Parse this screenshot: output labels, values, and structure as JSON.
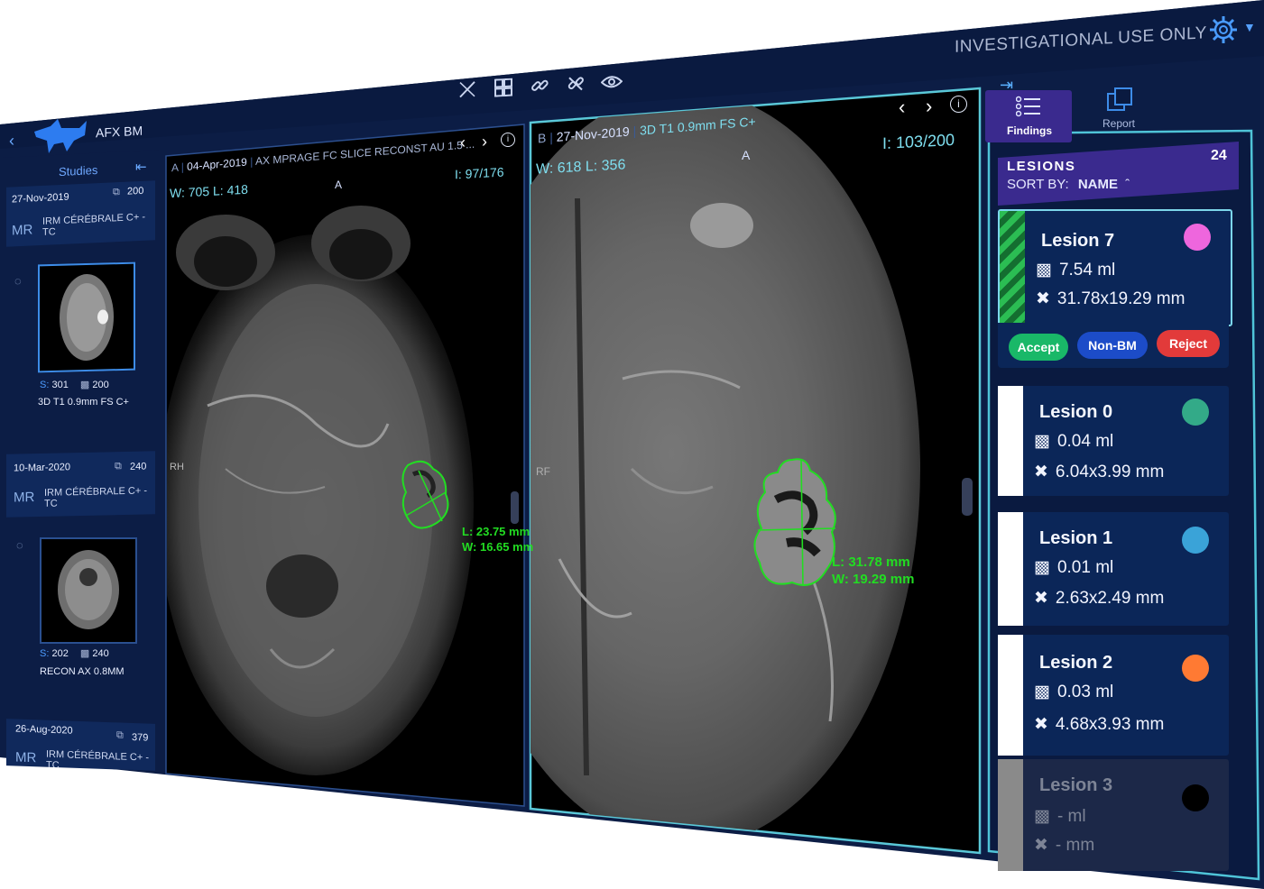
{
  "header": {
    "disclaimer": "INVESTIGATIONAL USE ONLY",
    "app_name": "AFX BM"
  },
  "toolbar": {
    "icons": [
      "measure-off-icon",
      "layout-grid-icon",
      "link-icon",
      "unlink-icon",
      "eye-icon"
    ]
  },
  "studies": {
    "title": "Studies",
    "items": [
      {
        "date": "27-Nov-2019",
        "count": "200",
        "modality": "MR",
        "description": "IRM CÉRÉBRALE C+ -TC",
        "series_s_label": "S:",
        "series_s": "301",
        "series_img": "200",
        "series_name": "3D T1 0.9mm FS C+"
      },
      {
        "date": "10-Mar-2020",
        "count": "240",
        "modality": "MR",
        "description": "IRM CÉRÉBRALE C+ -TC",
        "series_s_label": "S:",
        "series_s": "202",
        "series_img": "240",
        "series_name": "RECON AX 0.8MM"
      },
      {
        "date": "26-Aug-2020",
        "count": "379",
        "modality": "MR",
        "description": "IRM CÉRÉBRALE C+ -TC"
      }
    ]
  },
  "viewer_a": {
    "label": "A",
    "date": "04-Apr-2019",
    "series": "AX MPRAGE FC SLICE RECONST AU 1.5 ...",
    "window": "W: 705",
    "level": "L: 418",
    "image_index": "I: 97/176",
    "orient_top": "A",
    "orient_left": "RH",
    "measure_l": "L: 23.75 mm",
    "measure_w": "W: 16.65 mm"
  },
  "viewer_b": {
    "label": "B",
    "date": "27-Nov-2019",
    "series": "3D T1 0.9mm FS C+",
    "window": "W: 618",
    "level": "L: 356",
    "image_index": "I: 103/200",
    "orient_top": "A",
    "orient_left": "RF",
    "measure_l": "L: 31.78 mm",
    "measure_w": "W: 19.29 mm"
  },
  "tabs": {
    "findings": "Findings",
    "report": "Report"
  },
  "lesions": {
    "title": "LESIONS",
    "count": "24",
    "sort_label": "SORT BY:",
    "sort_value": "NAME",
    "items": [
      {
        "name": "Lesion 7",
        "volume": "7.54 ml",
        "size": "31.78x19.29 mm",
        "color": "#ee66dd"
      },
      {
        "name": "Lesion 0",
        "volume": "0.04 ml",
        "size": "6.04x3.99 mm",
        "color": "#33aa88"
      },
      {
        "name": "Lesion 1",
        "volume": "0.01 ml",
        "size": "2.63x2.49 mm",
        "color": "#3aa3d8"
      },
      {
        "name": "Lesion 2",
        "volume": "0.03 ml",
        "size": "4.68x3.93 mm",
        "color": "#ff7a33"
      },
      {
        "name": "Lesion 3",
        "volume": "- ml",
        "size": "- mm",
        "color": "#000000"
      }
    ],
    "actions": {
      "accept": "Accept",
      "non_bm": "Non-BM",
      "reject": "Reject"
    }
  }
}
